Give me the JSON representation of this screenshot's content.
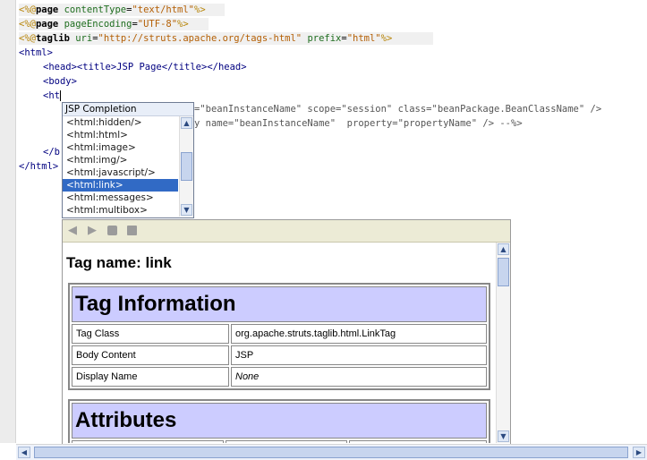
{
  "code": {
    "line1": {
      "open": "<%@",
      "kw": "page",
      "attr": "contentType",
      "eq": "=",
      "val": "\"text/html\"",
      "close": "%>"
    },
    "line2": {
      "open": "<%@",
      "kw": "page",
      "attr": "pageEncoding",
      "eq": "=",
      "val": "\"UTF-8\"",
      "close": "%>"
    },
    "line3": {
      "open": "<%@",
      "kw": "taglib",
      "attr1": "uri",
      "eq1": "=",
      "val1": "\"http://struts.apache.org/tags-html\"",
      "attr2": "prefix",
      "eq2": "=",
      "val2": "\"html\"",
      "close": "%>"
    },
    "line4": "<html>",
    "line5": "<head><title>JSP Page</title></head>",
    "line6": "<body>",
    "line7": "<ht",
    "line8_rest": "=\"beanInstanceName\" scope=\"session\" class=\"beanPackage.BeanClassName\" />",
    "line9_rest": "y name=\"beanInstanceName\"  property=\"propertyName\" /> --%>",
    "line10": "</b",
    "line11": "</html>"
  },
  "completion": {
    "header": "JSP Completion",
    "items": [
      "<html:hidden/>",
      "<html:html>",
      "<html:image>",
      "<html:img/>",
      "<html:javascript/>",
      "<html:link>",
      "<html:messages>",
      "<html:multibox>"
    ],
    "selected_index": 5
  },
  "doc": {
    "tag_name": "Tag name: link",
    "info_heading": "Tag Information",
    "rows": [
      {
        "label": "Tag Class",
        "value": "org.apache.struts.taglib.html.LinkTag"
      },
      {
        "label": "Body Content",
        "value": "JSP"
      },
      {
        "label": "Display Name",
        "value": "None"
      }
    ],
    "attributes_heading": "Attributes"
  },
  "icons": {
    "back": "back-arrow-icon",
    "forward": "forward-arrow-icon",
    "open_browser": "open-in-browser-icon",
    "open_source": "open-source-icon"
  }
}
